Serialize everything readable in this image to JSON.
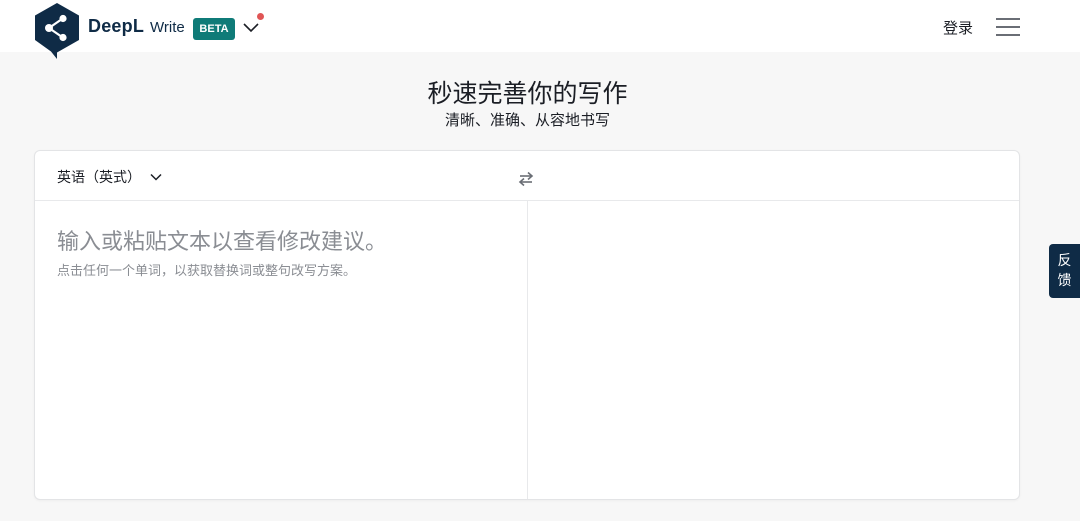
{
  "header": {
    "brand": "DeepL",
    "product": "Write",
    "badge": "BETA",
    "login_label": "登录",
    "icons": {
      "logo": "deepl-logo-icon",
      "dropdown": "chevron-down-icon",
      "menu": "hamburger-menu-icon"
    }
  },
  "hero": {
    "title": "秒速完善你的写作",
    "subtitle": "清晰、准确、从容地书写"
  },
  "editor": {
    "language": "英语（英式）",
    "placeholder": "输入或粘贴文本以查看修改建议。",
    "hint": "点击任何一个单词，以获取替换词或整句改写方案。",
    "output_text": "",
    "icons": {
      "language_dropdown": "chevron-down-icon",
      "swap": "swap-arrows-icon"
    }
  },
  "feedback": {
    "line1": "反",
    "line2": "馈"
  },
  "colors": {
    "brand_navy": "#0f2b46",
    "beta_teal": "#0f7b78",
    "notification_red": "#e05555",
    "page_background": "#f7f7f7"
  }
}
